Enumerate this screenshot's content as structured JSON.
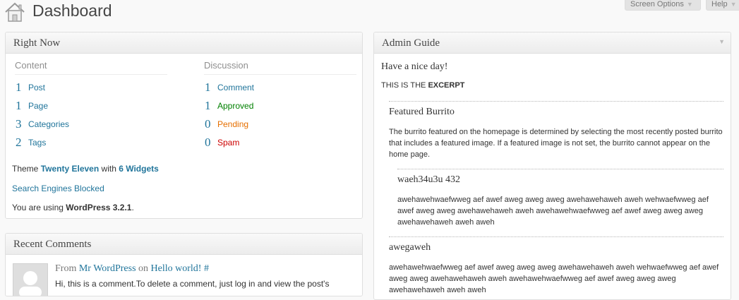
{
  "header": {
    "title": "Dashboard",
    "screen_options": "Screen Options",
    "help": "Help"
  },
  "right_now": {
    "title": "Right Now",
    "content_heading": "Content",
    "discussion_heading": "Discussion",
    "content": [
      {
        "count": "1",
        "label": "Post"
      },
      {
        "count": "1",
        "label": "Page"
      },
      {
        "count": "3",
        "label": "Categories"
      },
      {
        "count": "2",
        "label": "Tags"
      }
    ],
    "discussion": [
      {
        "count": "1",
        "label": "Comment"
      },
      {
        "count": "1",
        "label": "Approved"
      },
      {
        "count": "0",
        "label": "Pending"
      },
      {
        "count": "0",
        "label": "Spam"
      }
    ],
    "theme_prefix": "Theme",
    "theme_name": "Twenty Eleven",
    "theme_with": "with",
    "widgets": "6 Widgets",
    "search_blocked": "Search Engines Blocked",
    "version_prefix": "You are using",
    "version": "WordPress 3.2.1",
    "version_suffix": "."
  },
  "recent_comments": {
    "title": "Recent Comments",
    "from": "From",
    "author": "Mr WordPress",
    "on": "on",
    "post": "Hello world!",
    "hash": "#",
    "excerpt": "Hi, this is a comment.To delete a comment, just log in and view the post's"
  },
  "admin_guide": {
    "title": "Admin Guide",
    "greeting": "Have a nice day!",
    "excerpt_prefix": "THIS IS THE",
    "excerpt_bold": "EXCERPT",
    "featured_title": "Featured Burrito",
    "featured_body": "The burrito featured on the homepage is determined by selecting the most recently posted burrito that includes a featured image.  If a featured image is not set, the burrito cannot appear on the home page.",
    "sub1_title": "waeh34u3u 432",
    "sub1_body": "awehawehwaefwweg aef awef aweg aweg aweg awehawehaweh aweh wehwaefwweg aef awef aweg aweg awehawehaweh aweh awehawehwaefwweg aef awef aweg aweg aweg awehawehaweh aweh aweh",
    "sub2_title": "awegaweh",
    "sub2_body": "awehawehwaefwweg aef awef aweg aweg aweg awehawehaweh aweh wehwaefwweg aef awef aweg aweg awehawehaweh aweh awehawehwaefwweg aef awef aweg aweg aweg awehawehaweh aweh aweh"
  }
}
